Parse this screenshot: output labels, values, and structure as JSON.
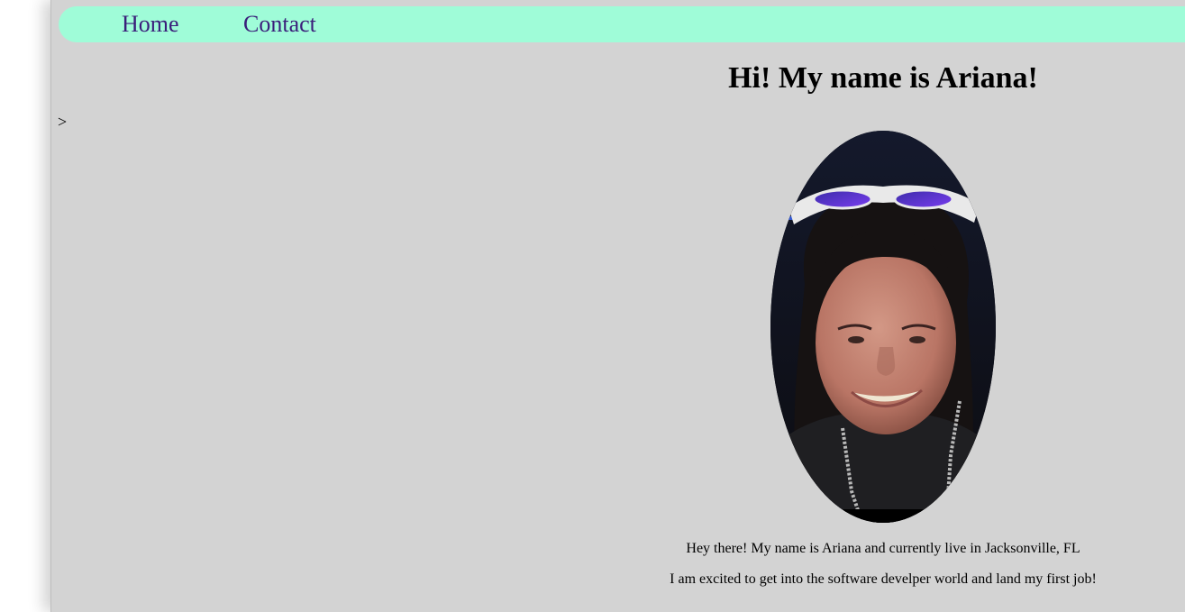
{
  "nav": {
    "home_label": "Home",
    "contact_label": "Contact"
  },
  "stray_text": ">",
  "main": {
    "heading": "Hi! My name is Ariana!",
    "photo_label": "Profile photo of Ariana",
    "intro_line_1": "Hey there! My name is Ariana and currently live in Jacksonville, FL",
    "intro_line_2": "I am excited to get into the software develper world and land my first job!"
  },
  "colors": {
    "page_background": "#d3d3d3",
    "navbar_background": "#9ffcd8",
    "nav_link_color": "#3a1e7a"
  }
}
